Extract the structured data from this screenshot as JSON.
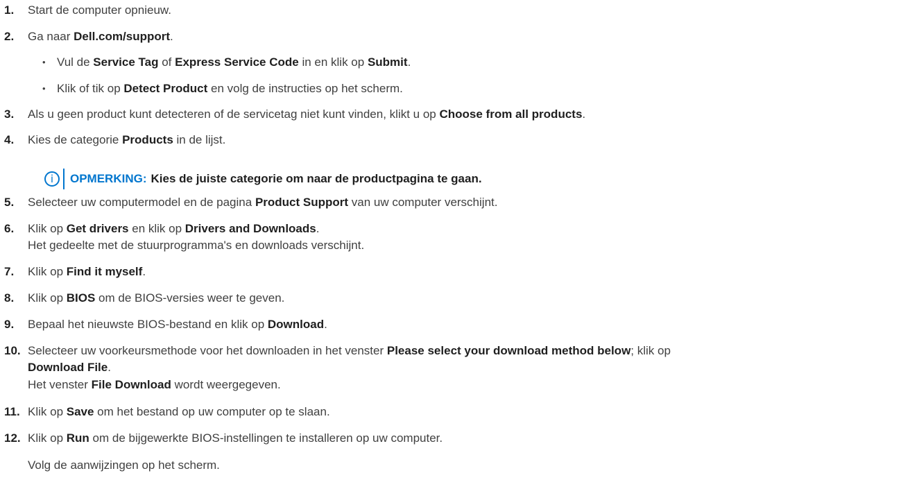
{
  "steps": [
    {
      "num": "1.",
      "parts": [
        {
          "t": "Start de computer opnieuw."
        }
      ]
    },
    {
      "num": "2.",
      "parts": [
        {
          "t": "Ga naar "
        },
        {
          "b": "Dell.com/support"
        },
        {
          "t": "."
        }
      ]
    },
    {
      "num": "3.",
      "parts": [
        {
          "t": "Als u geen product kunt detecteren of de servicetag niet kunt vinden, klikt u op "
        },
        {
          "b": "Choose from all products"
        },
        {
          "t": "."
        }
      ]
    },
    {
      "num": "4.",
      "parts": [
        {
          "t": "Kies de categorie "
        },
        {
          "b": "Products"
        },
        {
          "t": " in de lijst."
        }
      ]
    },
    {
      "num": "5.",
      "parts": [
        {
          "t": "Selecteer uw computermodel en de pagina "
        },
        {
          "b": "Product Support"
        },
        {
          "t": " van uw computer verschijnt."
        }
      ]
    },
    {
      "num": "6.",
      "parts": [
        {
          "t": "Klik op "
        },
        {
          "b": "Get drivers"
        },
        {
          "t": " en klik op "
        },
        {
          "b": "Drivers and Downloads"
        },
        {
          "t": "."
        }
      ]
    },
    {
      "num": "",
      "parts": [
        {
          "t": "Het gedeelte met de stuurprogramma's en downloads verschijnt."
        }
      ]
    },
    {
      "num": "7.",
      "parts": [
        {
          "t": "Klik op "
        },
        {
          "b": "Find it myself"
        },
        {
          "t": "."
        }
      ]
    },
    {
      "num": "8.",
      "parts": [
        {
          "t": "Klik op "
        },
        {
          "b": "BIOS"
        },
        {
          "t": " om de BIOS-versies weer te geven."
        }
      ]
    },
    {
      "num": "9.",
      "parts": [
        {
          "t": "Bepaal het nieuwste BIOS-bestand en klik op "
        },
        {
          "b": "Download"
        },
        {
          "t": "."
        }
      ]
    },
    {
      "num": "10.",
      "parts": [
        {
          "t": "Selecteer uw voorkeursmethode voor het downloaden in het venster "
        },
        {
          "b": "Please select your download method below"
        },
        {
          "t": "; klik op"
        }
      ]
    },
    {
      "num": "",
      "parts": [
        {
          "b": "Download File"
        },
        {
          "t": "."
        }
      ]
    },
    {
      "num": "",
      "parts": [
        {
          "t": "Het venster "
        },
        {
          "b": "File Download"
        },
        {
          "t": " wordt weergegeven."
        }
      ]
    },
    {
      "num": "11.",
      "parts": [
        {
          "t": "Klik op "
        },
        {
          "b": "Save"
        },
        {
          "t": " om het bestand op uw computer op te slaan."
        }
      ]
    },
    {
      "num": "12.",
      "parts": [
        {
          "t": "Klik op "
        },
        {
          "b": "Run"
        },
        {
          "t": " om de bijgewerkte BIOS-instellingen te installeren op uw computer."
        }
      ]
    },
    {
      "num": "",
      "parts": [
        {
          "t": "Volg de aanwijzingen op het scherm."
        }
      ]
    }
  ],
  "bullets": [
    {
      "parts": [
        {
          "t": "Vul de "
        },
        {
          "b": "Service Tag"
        },
        {
          "t": " of "
        },
        {
          "b": "Express Service Code"
        },
        {
          "t": " in en klik op "
        },
        {
          "b": "Submit"
        },
        {
          "t": "."
        }
      ]
    },
    {
      "parts": [
        {
          "t": "Klik of tik op "
        },
        {
          "b": "Detect Product"
        },
        {
          "t": " en volg de instructies op het scherm."
        }
      ]
    }
  ],
  "bullet_glyph": "•",
  "note": {
    "icon": "info-icon",
    "icon_glyph": "i",
    "label": "OPMERKING:",
    "text": "Kies de juiste categorie om naar de productpagina te gaan.",
    "color": "#0076ce"
  }
}
